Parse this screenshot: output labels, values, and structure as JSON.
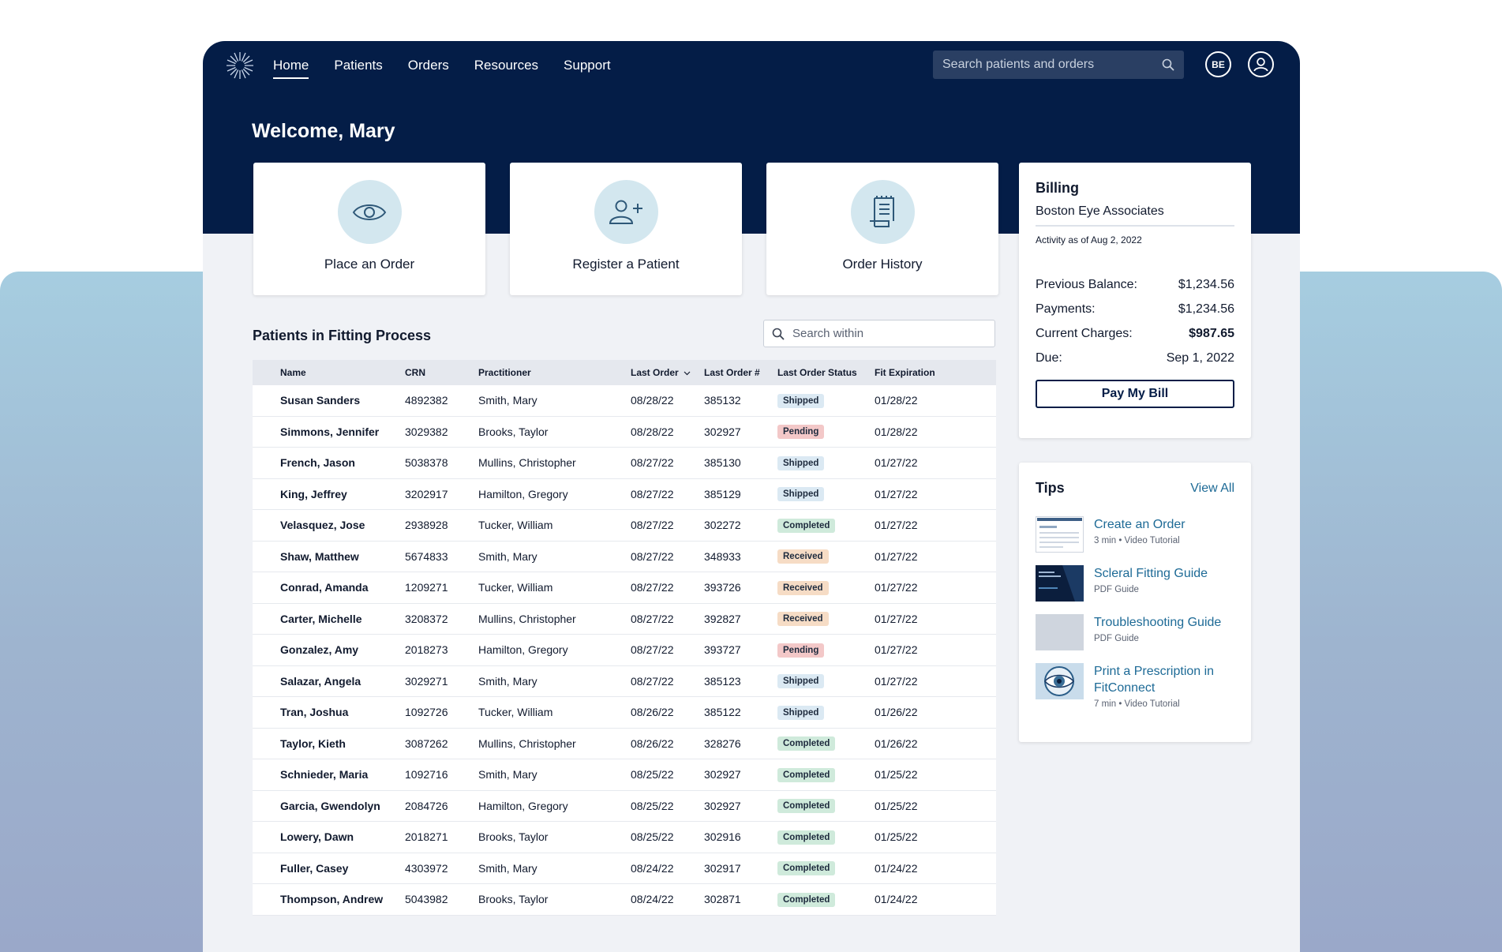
{
  "nav": {
    "items": [
      "Home",
      "Patients",
      "Orders",
      "Resources",
      "Support"
    ],
    "active": "Home"
  },
  "search": {
    "placeholder": "Search patients and orders"
  },
  "account": {
    "initials": "BE"
  },
  "welcome": "Welcome, Mary",
  "actions": [
    {
      "label": "Place an Order",
      "icon": "eye-icon"
    },
    {
      "label": "Register a Patient",
      "icon": "add-user-icon"
    },
    {
      "label": "Order History",
      "icon": "receipt-icon"
    }
  ],
  "billing": {
    "title": "Billing",
    "org": "Boston Eye Associates",
    "as_of": "Activity as of Aug 2, 2022",
    "rows": [
      {
        "label": "Previous Balance:",
        "value": "$1,234.56"
      },
      {
        "label": "Payments:",
        "value": "$1,234.56"
      },
      {
        "label": "Current Charges:",
        "value": "$987.65"
      },
      {
        "label": "Due:",
        "value": "Sep 1, 2022"
      }
    ],
    "pay_label": "Pay My Bill"
  },
  "tips": {
    "title": "Tips",
    "view_all": "View All",
    "items": [
      {
        "title": "Create an Order",
        "sub": "3 min • Video Tutorial"
      },
      {
        "title": "Scleral Fitting Guide",
        "sub": "PDF Guide"
      },
      {
        "title": "Troubleshooting Guide",
        "sub": "PDF Guide"
      },
      {
        "title": "Print a Prescription in FitConnect",
        "sub": "7 min • Video Tutorial"
      }
    ]
  },
  "patients": {
    "title": "Patients in Fitting Process",
    "search_placeholder": "Search within",
    "columns": [
      "Name",
      "CRN",
      "Practitioner",
      "Last Order",
      "Last Order #",
      "Last Order Status",
      "Fit Expiration"
    ],
    "rows": [
      [
        "Susan Sanders",
        "4892382",
        "Smith, Mary",
        "08/28/22",
        "385132",
        "Shipped",
        "01/28/22"
      ],
      [
        "Simmons, Jennifer",
        "3029382",
        "Brooks, Taylor",
        "08/28/22",
        "302927",
        "Pending",
        "01/28/22"
      ],
      [
        "French, Jason",
        "5038378",
        "Mullins, Christopher",
        "08/27/22",
        "385130",
        "Shipped",
        "01/27/22"
      ],
      [
        "King, Jeffrey",
        "3202917",
        "Hamilton, Gregory",
        "08/27/22",
        "385129",
        "Shipped",
        "01/27/22"
      ],
      [
        "Velasquez, Jose",
        "2938928",
        "Tucker, William",
        "08/27/22",
        "302272",
        "Completed",
        "01/27/22"
      ],
      [
        "Shaw, Matthew",
        "5674833",
        "Smith, Mary",
        "08/27/22",
        "348933",
        "Received",
        "01/27/22"
      ],
      [
        "Conrad, Amanda",
        "1209271",
        "Tucker, William",
        "08/27/22",
        "393726",
        "Received",
        "01/27/22"
      ],
      [
        "Carter, Michelle",
        "3208372",
        "Mullins, Christopher",
        "08/27/22",
        "392827",
        "Received",
        "01/27/22"
      ],
      [
        "Gonzalez, Amy",
        "2018273",
        "Hamilton, Gregory",
        "08/27/22",
        "393727",
        "Pending",
        "01/27/22"
      ],
      [
        "Salazar, Angela",
        "3029271",
        "Smith, Mary",
        "08/27/22",
        "385123",
        "Shipped",
        "01/27/22"
      ],
      [
        "Tran, Joshua",
        "1092726",
        "Tucker, William",
        "08/26/22",
        "385122",
        "Shipped",
        "01/26/22"
      ],
      [
        "Taylor, Kieth",
        "3087262",
        "Mullins, Christopher",
        "08/26/22",
        "328276",
        "Completed",
        "01/26/22"
      ],
      [
        "Schnieder, Maria",
        "1092716",
        "Smith, Mary",
        "08/25/22",
        "302927",
        "Completed",
        "01/25/22"
      ],
      [
        "Garcia, Gwendolyn",
        "2084726",
        "Hamilton, Gregory",
        "08/25/22",
        "302927",
        "Completed",
        "01/25/22"
      ],
      [
        "Lowery, Dawn",
        "2018271",
        "Brooks, Taylor",
        "08/25/22",
        "302916",
        "Completed",
        "01/25/22"
      ],
      [
        "Fuller, Casey",
        "4303972",
        "Smith, Mary",
        "08/24/22",
        "302917",
        "Completed",
        "01/24/22"
      ],
      [
        "Thompson, Andrew",
        "5043982",
        "Brooks, Taylor",
        "08/24/22",
        "302871",
        "Completed",
        "01/24/22"
      ]
    ]
  },
  "colors": {
    "navy": "#041d47",
    "link": "#1d6a96",
    "shipped": "#dbe9f3",
    "pending": "#f3c8c8",
    "completed": "#cfeadb",
    "received": "#f6dcc5"
  }
}
